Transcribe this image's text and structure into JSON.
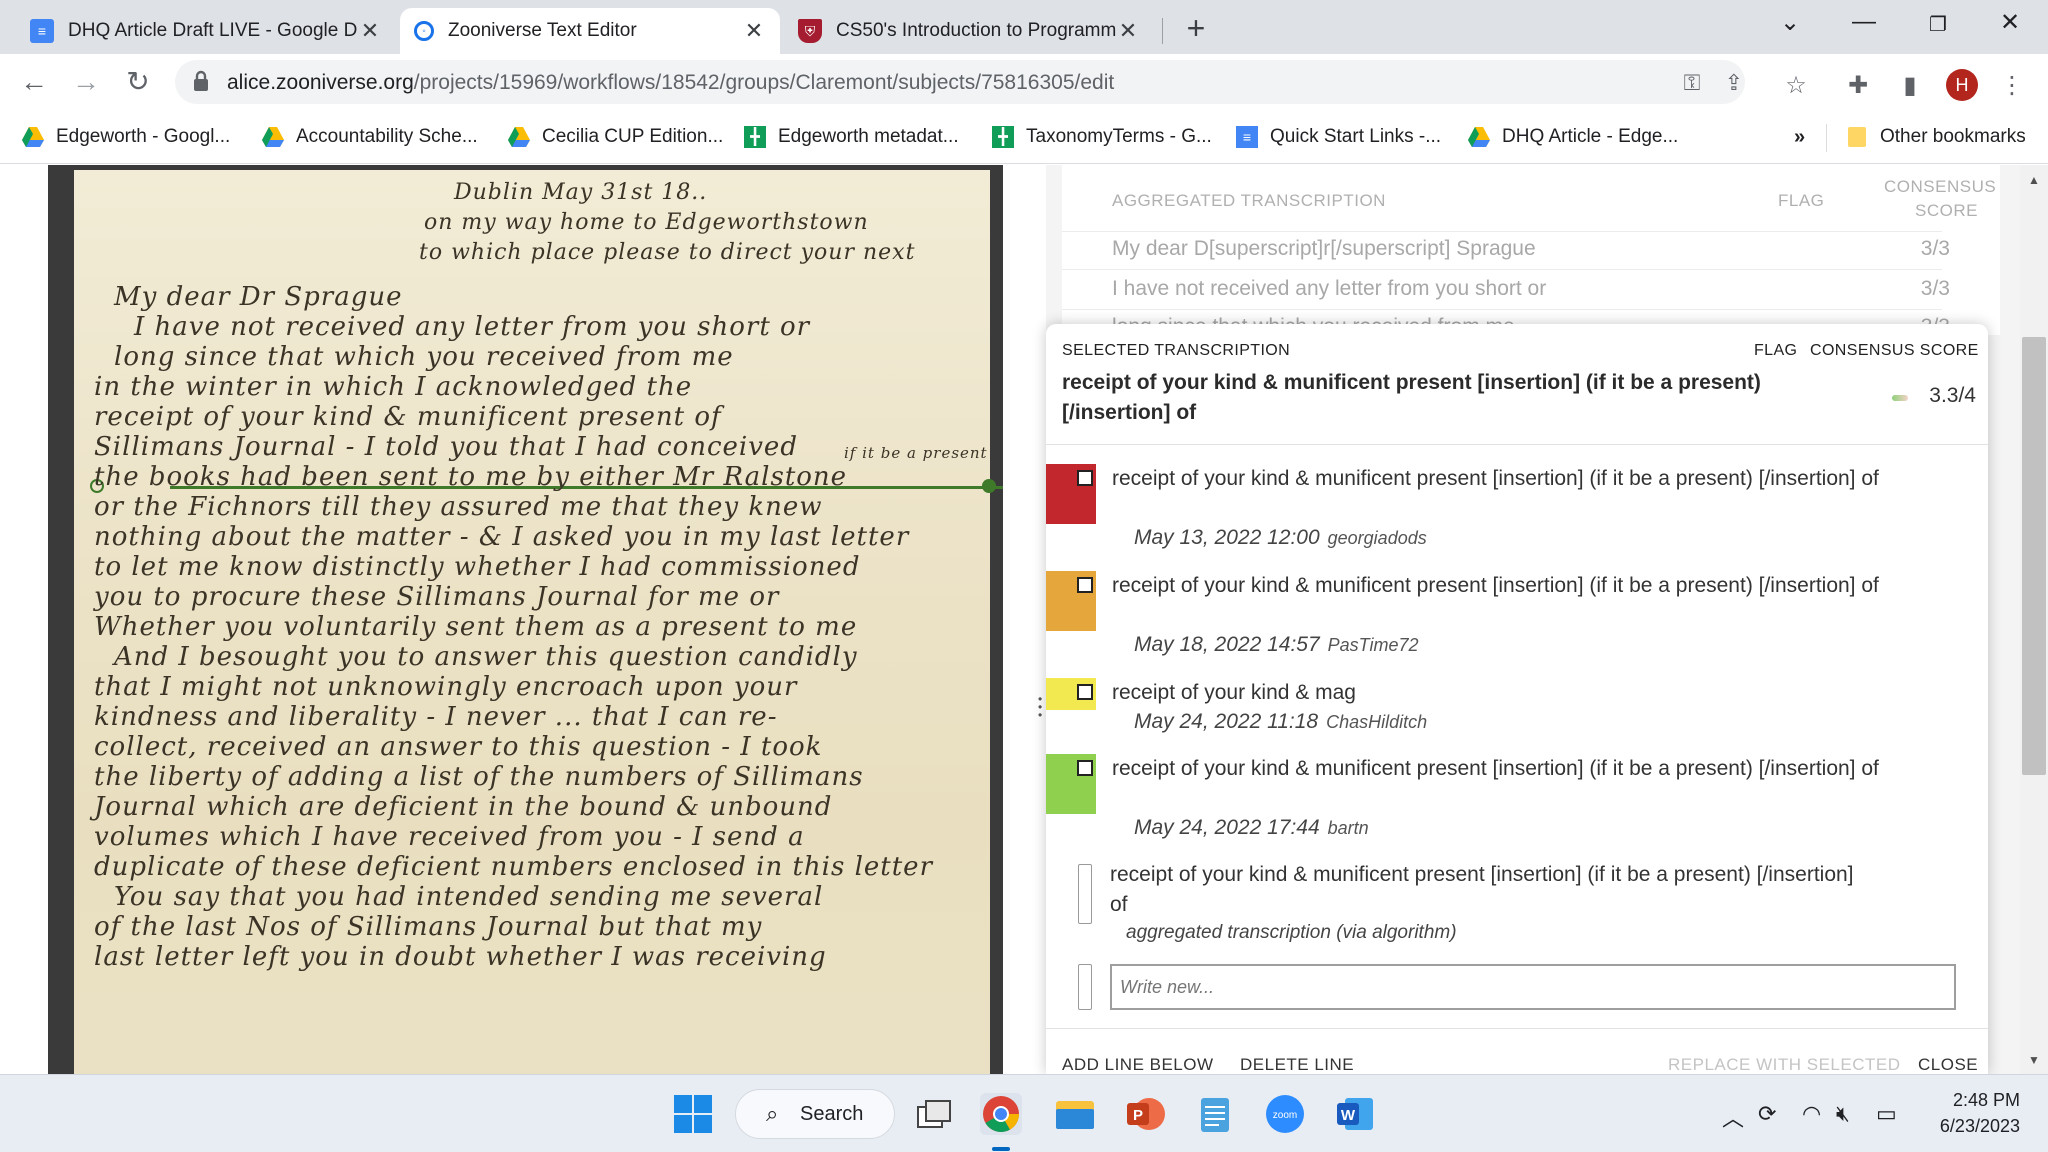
{
  "browser": {
    "tabs": [
      {
        "title": "DHQ Article Draft LIVE - Google D",
        "active": false,
        "favicon": "google-docs-icon"
      },
      {
        "title": "Zooniverse Text Editor",
        "active": true,
        "favicon": "zooniverse-icon"
      },
      {
        "title": "CS50's Introduction to Programm",
        "active": false,
        "favicon": "harvard-shield-icon"
      }
    ],
    "new_tab": "+",
    "url_host": "alice.zooniverse.org",
    "url_path": "/projects/15969/workflows/18542/groups/Claremont/subjects/75816305/edit",
    "avatar_initial": "H",
    "bookmarks": [
      {
        "label": "Edgeworth - Googl...",
        "icon": "google-drive-icon"
      },
      {
        "label": "Accountability Sche...",
        "icon": "google-drive-icon"
      },
      {
        "label": "Cecilia CUP Edition...",
        "icon": "google-drive-icon"
      },
      {
        "label": "Edgeworth metadat...",
        "icon": "google-sheets-icon"
      },
      {
        "label": "TaxonomyTerms - G...",
        "icon": "google-sheets-icon"
      },
      {
        "label": "Quick Start Links -...",
        "icon": "google-docs-icon"
      },
      {
        "label": "DHQ Article - Edge...",
        "icon": "google-drive-icon"
      }
    ],
    "bookmarks_overflow": "»",
    "other_bookmarks": "Other bookmarks"
  },
  "manuscript": {
    "lines": [
      "Dublin May 31st 18..",
      "on my way home to Edgeworthstown",
      "to which place please to direct your next",
      "My dear Dr Sprague",
      "I have not received any letter from you short or",
      "long since that which you received from me",
      "in the winter in which I acknowledged the",
      "receipt of your kind & munificent present of",
      "Sillimans Journal - I told you that I had conceived",
      "the books had been sent to me by either Mr Ralstone",
      "or the Fichnors till they assured me that they knew",
      "nothing about the matter - & I asked you in my last letter",
      "to let me know distinctly whether I had commissioned",
      "you to procure these Sillimans Journal for me or",
      "Whether you voluntarily sent them as a present to me",
      "And I besought you to answer this question candidly",
      "that I might not unknowingly encroach upon your",
      "kindness and liberality - I never ... that I can re-",
      "collect, received an answer to this question - I took",
      "the liberty of adding a list of the numbers of Sillimans",
      "Journal which are deficient in the bound & unbound",
      "volumes which I have received from you - I send a",
      "duplicate of these deficient numbers enclosed in this letter",
      "You say that you had intended sending me several",
      "of the last Nos of Sillimans Journal but that my",
      "last letter left you in doubt whether I was receiving"
    ],
    "insertion_note": "if it be a present"
  },
  "aggregated": {
    "header_label": "AGGREGATED TRANSCRIPTION",
    "flag_label": "FLAG",
    "score_label_1": "CONSENSUS",
    "score_label_2": "SCORE",
    "rows": [
      {
        "text": "My dear D[superscript]r[/superscript] Sprague",
        "score": "3/3"
      },
      {
        "text": "I have not received any letter from you short or",
        "score": "3/3"
      },
      {
        "text": "long since that which you received from me",
        "score": "3/3"
      }
    ]
  },
  "selected": {
    "label": "SELECTED TRANSCRIPTION",
    "flag_label": "FLAG",
    "score_label": "CONSENSUS SCORE",
    "text": "receipt of your kind & munificent present [insertion] (if it be a present) [/insertion] of",
    "score": "3.3/4",
    "entries": [
      {
        "text": "receipt of your kind & munificent present [insertion] (if it be a present) [/insertion] of",
        "date": "May 13, 2022 12:00",
        "user": "georgiadods",
        "color": "#c1272d"
      },
      {
        "text": "receipt of your kind & munificent present [insertion] (if it be a present) [/insertion] of",
        "date": "May 18, 2022 14:57",
        "user": "PasTime72",
        "color": "#e5a63b"
      },
      {
        "text": "receipt of your kind & mag",
        "date": "May 24, 2022 11:18",
        "user": "ChasHilditch",
        "color": "#f1e94f"
      },
      {
        "text": "receipt of your kind & munificent present [insertion] (if it be a present) [/insertion] of",
        "date": "May 24, 2022 17:44",
        "user": "bartn",
        "color": "#8fd14f"
      }
    ],
    "algorithm_text": "receipt of your kind & munificent present [insertion] (if it be a present) [/insertion] of",
    "algorithm_label": "aggregated transcription (via algorithm)",
    "write_placeholder": "Write new...",
    "actions": {
      "add_line": "ADD LINE BELOW",
      "delete_line": "DELETE LINE",
      "replace": "REPLACE WITH SELECTED",
      "close": "CLOSE"
    }
  },
  "taskbar": {
    "search_label": "Search",
    "time": "2:48 PM",
    "date": "6/23/2023",
    "zoom_label": "zoom"
  }
}
